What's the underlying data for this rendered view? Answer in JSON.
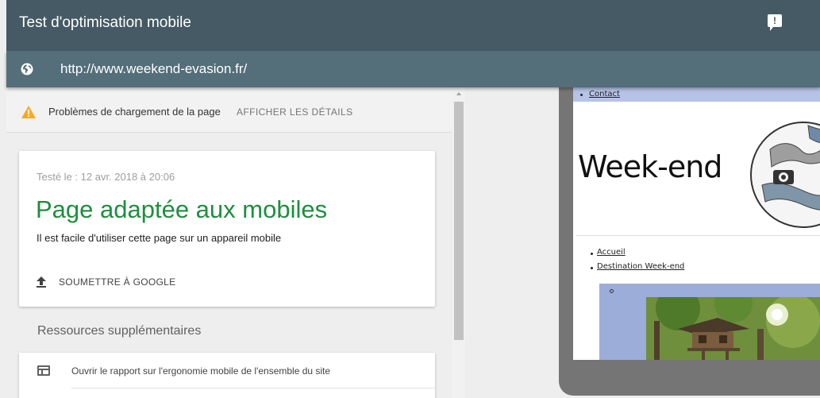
{
  "header": {
    "title": "Test d'optimisation mobile",
    "feedback_icon_name": "feedback-icon"
  },
  "urlbar": {
    "url": "http://www.weekend-evasion.fr/",
    "icon_name": "globe-icon"
  },
  "warning": {
    "text": "Problèmes de chargement de la page",
    "link_label": "AFFICHER LES DÉTAILS",
    "icon_name": "warning-icon",
    "color": "#f9a825"
  },
  "result": {
    "tested": "Testé le : 12 avr. 2018 à 20:06",
    "title": "Page adaptée aux mobiles",
    "description": "Il est facile d'utiliser cette page sur un appareil mobile",
    "submit_label": "SOUMETTRE À GOOGLE",
    "title_color": "#1e8e3e"
  },
  "resources": {
    "heading": "Ressources supplémentaires",
    "items": [
      {
        "label": "Ouvrir le rapport sur l'ergonomie mobile de l'ensemble du site",
        "icon_name": "report-icon"
      }
    ]
  },
  "preview": {
    "nav_top": "Contact",
    "site_title": "Week-end",
    "nav_items": [
      "Accueil",
      "Destination Week-end"
    ]
  },
  "colors": {
    "header": "#455a64",
    "urlbar": "#546e7a",
    "nav_background": "#b6c3e6",
    "content_background": "#9badd8"
  }
}
